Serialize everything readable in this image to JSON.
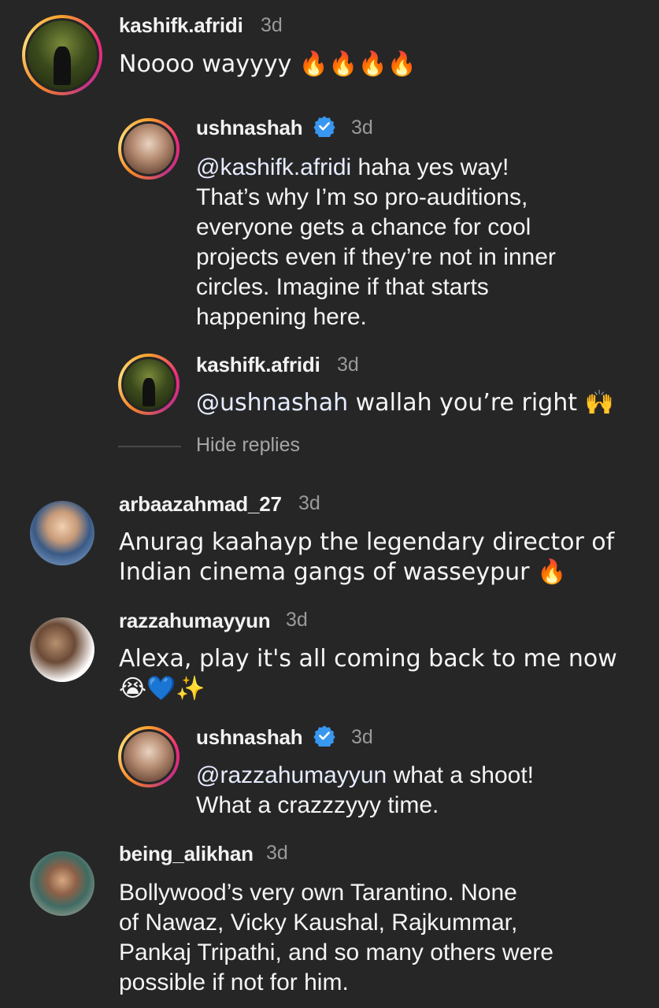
{
  "comments": [
    {
      "username": "kashifk.afridi",
      "time": "3d",
      "text": "Noooo wayyyy 🔥🔥🔥🔥",
      "avatar": "kashif-avatar",
      "story_ring": true
    },
    {
      "username": "ushnashah",
      "verified": true,
      "time": "3d",
      "mention": "@kashifk.afridi",
      "lines": [
        " haha yes way!",
        "That’s why I’m so pro-auditions,",
        "everyone gets a chance for cool",
        "projects even if they’re not in inner",
        "circles. Imagine if that starts",
        "happening here."
      ],
      "avatar": "ushna-avatar",
      "story_ring": true
    },
    {
      "username": "kashifk.afridi",
      "time": "3d",
      "mention": "@ushnashah",
      "text": " wallah you’re right 🙌",
      "avatar": "kashif-avatar",
      "story_ring": true
    },
    {
      "hide_replies": "Hide replies"
    },
    {
      "username": "arbaazahmad_27",
      "time": "3d",
      "lines": [
        "Anurag kaahayp the legendary director of",
        "Indian cinema gangs of wasseypur 🔥"
      ],
      "avatar": "arbaaz-avatar"
    },
    {
      "username": "razzahumayyun",
      "time": "3d",
      "lines": [
        "Alexa, play it's all coming back to me now",
        "😭💙✨"
      ],
      "avatar": "razza-avatar"
    },
    {
      "username": "ushnashah",
      "verified": true,
      "time": "3d",
      "mention": "@razzahumayyun",
      "lines": [
        " what a shoot!",
        "What a crazzzyyy time."
      ],
      "avatar": "ushna-avatar",
      "story_ring": true
    },
    {
      "username": "being_alikhan",
      "time": "3d",
      "lines": [
        "Bollywood’s very own Tarantino. None",
        "of Nawaz, Vicky Kaushal, Rajkummar,",
        "Pankaj Tripathi, and so many others were",
        "possible if not for him."
      ],
      "avatar": "being-avatar"
    }
  ],
  "colors": {
    "background": "#262626",
    "verified_blue": "#3897f0",
    "secondary_text": "#9a9a9a"
  }
}
